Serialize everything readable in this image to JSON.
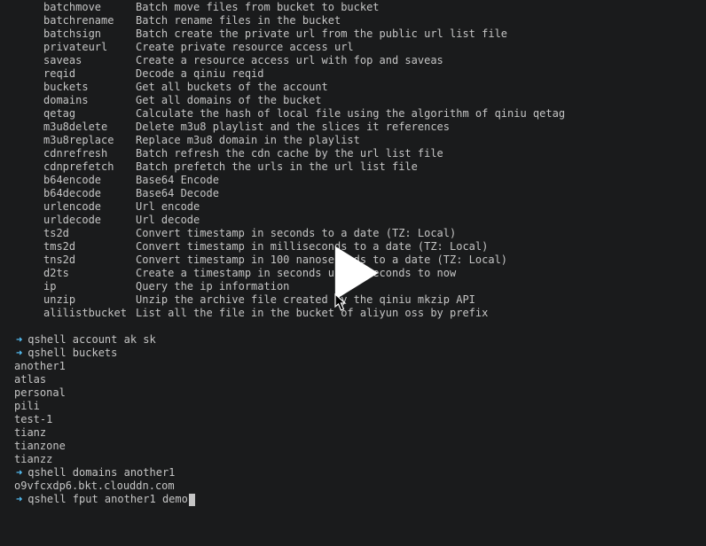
{
  "commands": [
    {
      "name": "batchmove",
      "desc": "Batch move files from bucket to bucket"
    },
    {
      "name": "batchrename",
      "desc": "Batch rename files in the bucket"
    },
    {
      "name": "batchsign",
      "desc": "Batch create the private url from the public url list file"
    },
    {
      "name": "privateurl",
      "desc": "Create private resource access url"
    },
    {
      "name": "saveas",
      "desc": "Create a resource access url with fop and saveas"
    },
    {
      "name": "reqid",
      "desc": "Decode a qiniu reqid"
    },
    {
      "name": "buckets",
      "desc": "Get all buckets of the account"
    },
    {
      "name": "domains",
      "desc": "Get all domains of the bucket"
    },
    {
      "name": "qetag",
      "desc": "Calculate the hash of local file using the algorithm of qiniu qetag"
    },
    {
      "name": "m3u8delete",
      "desc": "Delete m3u8 playlist and the slices it references"
    },
    {
      "name": "m3u8replace",
      "desc": "Replace m3u8 domain in the playlist"
    },
    {
      "name": "cdnrefresh",
      "desc": "Batch refresh the cdn cache by the url list file"
    },
    {
      "name": "cdnprefetch",
      "desc": "Batch prefetch the urls in the url list file"
    },
    {
      "name": "b64encode",
      "desc": "Base64 Encode"
    },
    {
      "name": "b64decode",
      "desc": "Base64 Decode"
    },
    {
      "name": "urlencode",
      "desc": "Url encode"
    },
    {
      "name": "urldecode",
      "desc": "Url decode"
    },
    {
      "name": "ts2d",
      "desc": "Convert timestamp in seconds to a date (TZ: Local)"
    },
    {
      "name": "tms2d",
      "desc": "Convert timestamp in milliseconds to a date (TZ: Local)"
    },
    {
      "name": "tns2d",
      "desc": "Convert timestamp in 100 nanoseconds to a date (TZ: Local)"
    },
    {
      "name": "d2ts",
      "desc": "Create a timestamp in seconds using seconds to now"
    },
    {
      "name": "ip",
      "desc": "Query the ip information"
    },
    {
      "name": "unzip",
      "desc": "Unzip the archive file created by the qiniu mkzip API"
    },
    {
      "name": "alilistbucket",
      "desc": "List all the file in the bucket of aliyun oss by prefix"
    }
  ],
  "prompt_symbol": "➜",
  "shell1": {
    "cmd": "qshell account ak sk"
  },
  "shell2": {
    "cmd": "qshell buckets"
  },
  "buckets_output": [
    "another1",
    "atlas",
    "personal",
    "pili",
    "test-1",
    "tianz",
    "tianzone",
    "tianzz"
  ],
  "shell3": {
    "cmd": "qshell domains another1"
  },
  "domains_output": [
    "o9vfcxdp6.bkt.clouddn.com"
  ],
  "shell4": {
    "cmd": "qshell fput another1 demo"
  }
}
